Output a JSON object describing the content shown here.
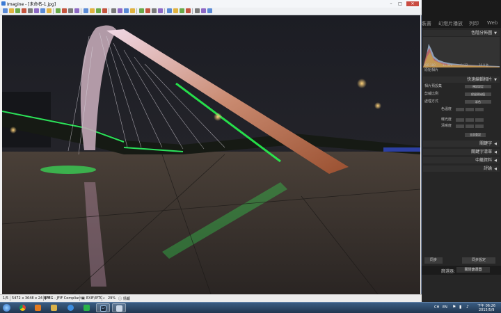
{
  "viewer": {
    "title": "Imagine - [未命名-1.jpg]",
    "window_controls": {
      "minimize": "–",
      "maximize": "□",
      "close": "✕"
    },
    "toolbar_icons": [
      "new-icon",
      "open-icon",
      "save-icon",
      "print-icon",
      "back-icon",
      "forward-icon",
      "folder-up-icon",
      "cut-icon",
      "copy-icon",
      "paste-icon",
      "undo-icon",
      "redo-icon",
      "info-icon",
      "convert-icon",
      "slideshow-icon",
      "photo-icon",
      "rotate-left-icon",
      "rotate-right-icon",
      "flip-icon",
      "crop-icon",
      "zoom-in-icon",
      "zoom-out-icon",
      "fit-icon",
      "actual-size-icon",
      "fullscreen-icon",
      "grid-icon",
      "thumbnails-icon",
      "browse-icon",
      "settings-icon",
      "plugin-icon",
      "help-icon"
    ],
    "status": {
      "page": "1/5",
      "dimensions": "5472 x 3648 x 24 BPP",
      "format": "JPEG - JFIF Compliant",
      "exif": "EXIF/IPTC",
      "zoom": "29%",
      "info": "情報"
    }
  },
  "lightroom": {
    "modules": [
      "裝書",
      "幻燈片播放",
      "列印",
      "Web"
    ],
    "histogram_label": "色階分佈圖",
    "histogram_info": [
      "ISO 100",
      "11 mm",
      "f / 22",
      "10.0 秒"
    ],
    "original_photo_label": "原始相片",
    "quick_develop_label": "快速編輯相片",
    "rows": [
      {
        "label": "相片預設集",
        "value": "預設設定"
      },
      {
        "label": "剪裁比例",
        "value": "保留原始值"
      },
      {
        "label": "處理方式",
        "value": "彩色"
      }
    ],
    "white_balance_label": "白平衡",
    "wb_value": "拍攝時設定",
    "temp_label": "色溫度",
    "tint_label": "色調",
    "tone_control_label": "色調控制",
    "exposure_label": "曝光度",
    "clarity_label": "清晰度",
    "vibrance_label": "細節飽和度",
    "reset_label": "全部重設",
    "keywording_label": "關鍵字",
    "keyword_list_label": "關鍵字清單",
    "metadata_label": "中繼資料",
    "comments_label": "評論",
    "left_btn": "同步",
    "right_btn": "同步設定",
    "filter_label": "篩選器:",
    "filter_value": "關閉篩選器"
  },
  "taskbar": {
    "apps": [
      "start-orb-icon",
      "chrome-icon",
      "media-player-icon",
      "folder-icon",
      "ie-icon",
      "line-icon",
      "lightroom-icon",
      "imagine-icon"
    ],
    "lr_label": "Lr",
    "tray_lang": "CH",
    "tray_en": "EN",
    "time": "下午 06:26",
    "date": "2015/5/9"
  },
  "colors": {
    "window_bg": "#f1f1f1",
    "taskbar_top": "#3a5d83",
    "lightroom_bg": "#262626",
    "bridge_glow": "#1bff4a"
  }
}
